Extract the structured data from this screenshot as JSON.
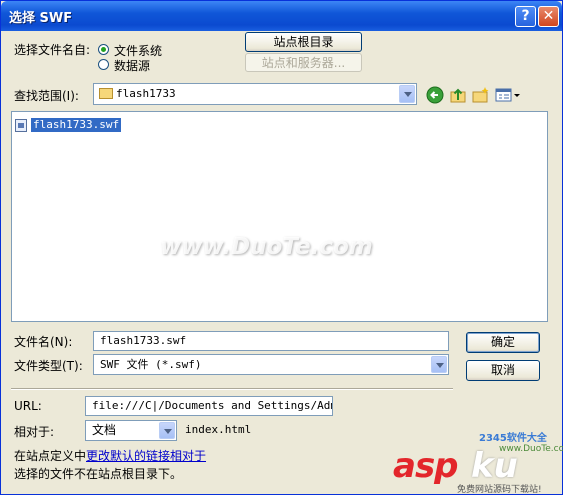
{
  "window": {
    "title": "选择 SWF",
    "help_glyph": "?",
    "close_glyph": "✕"
  },
  "select_from": {
    "label": "选择文件名自:",
    "options": [
      {
        "label": "文件系统",
        "selected": true
      },
      {
        "label": "数据源",
        "selected": false
      }
    ],
    "site_root_button": "站点根目录",
    "sites_servers_button": "站点和服务器..."
  },
  "lookin": {
    "label": "查找范围(I):",
    "value": "flash1733",
    "icons": [
      "back-icon",
      "up-folder-icon",
      "new-folder-icon",
      "view-menu-icon"
    ]
  },
  "files": [
    {
      "name": "flash1733.swf",
      "selected": true
    }
  ],
  "watermark": "www.DuoTe.com",
  "filename": {
    "label": "文件名(N):",
    "value": "flash1733.swf"
  },
  "filetype": {
    "label": "文件类型(T):",
    "value": "SWF 文件 (*.swf)"
  },
  "ok_button": "确定",
  "cancel_button": "取消",
  "url": {
    "label": "URL:",
    "value": "file:///C|/Documents and Settings/Admini:"
  },
  "relative": {
    "label": "相对于:",
    "value": "文档",
    "page": "index.html"
  },
  "footer": {
    "change_prefix": "在站点定义中",
    "change_link": "更改默认的链接相对于",
    "note": "选择的文件不在站点根目录下。"
  },
  "logos": {
    "site_2345": "2345软件大全",
    "duote_url": "www.DuoTe.com",
    "asp": "asp",
    "ku": "ku",
    "bottom": "免费网站源码下载站!"
  },
  "colors": {
    "titlebar": "#0b4ad0",
    "selection": "#316ac5",
    "link": "#0000cc"
  }
}
